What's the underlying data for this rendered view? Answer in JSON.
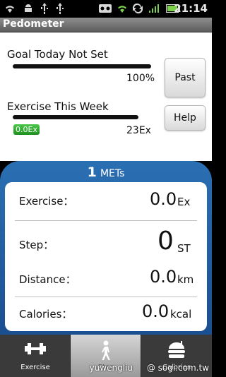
{
  "status": {
    "time": "21:14"
  },
  "app": {
    "title": "Pedometer"
  },
  "goal": {
    "label": "Goal Today Not Set",
    "percent_text": "100%"
  },
  "week": {
    "label": "Exercise This Week",
    "badge": "0.0Ex",
    "total": "23Ex"
  },
  "buttons": {
    "past": "Past",
    "help": "Help"
  },
  "mets": {
    "value": "1",
    "unit": "METs"
  },
  "stats": [
    {
      "label": "Exercise：",
      "value": "0.0",
      "unit": "Ex"
    },
    {
      "label": "Step：",
      "value": "0",
      "unit": "ST"
    },
    {
      "label": "Distance：",
      "value": "0.0",
      "unit": "km"
    },
    {
      "label": "Calories：",
      "value": "0.0",
      "unit": "kcal"
    }
  ],
  "tabs": [
    {
      "label": "Exercise",
      "icon": "dumbbell-icon"
    },
    {
      "label": "Step",
      "icon": "walking-person-icon"
    },
    {
      "label": "Calories",
      "icon": "burger-icon"
    }
  ],
  "watermark": {
    "user": "yuwengliu",
    "site": "@ sogi.com.tw"
  }
}
